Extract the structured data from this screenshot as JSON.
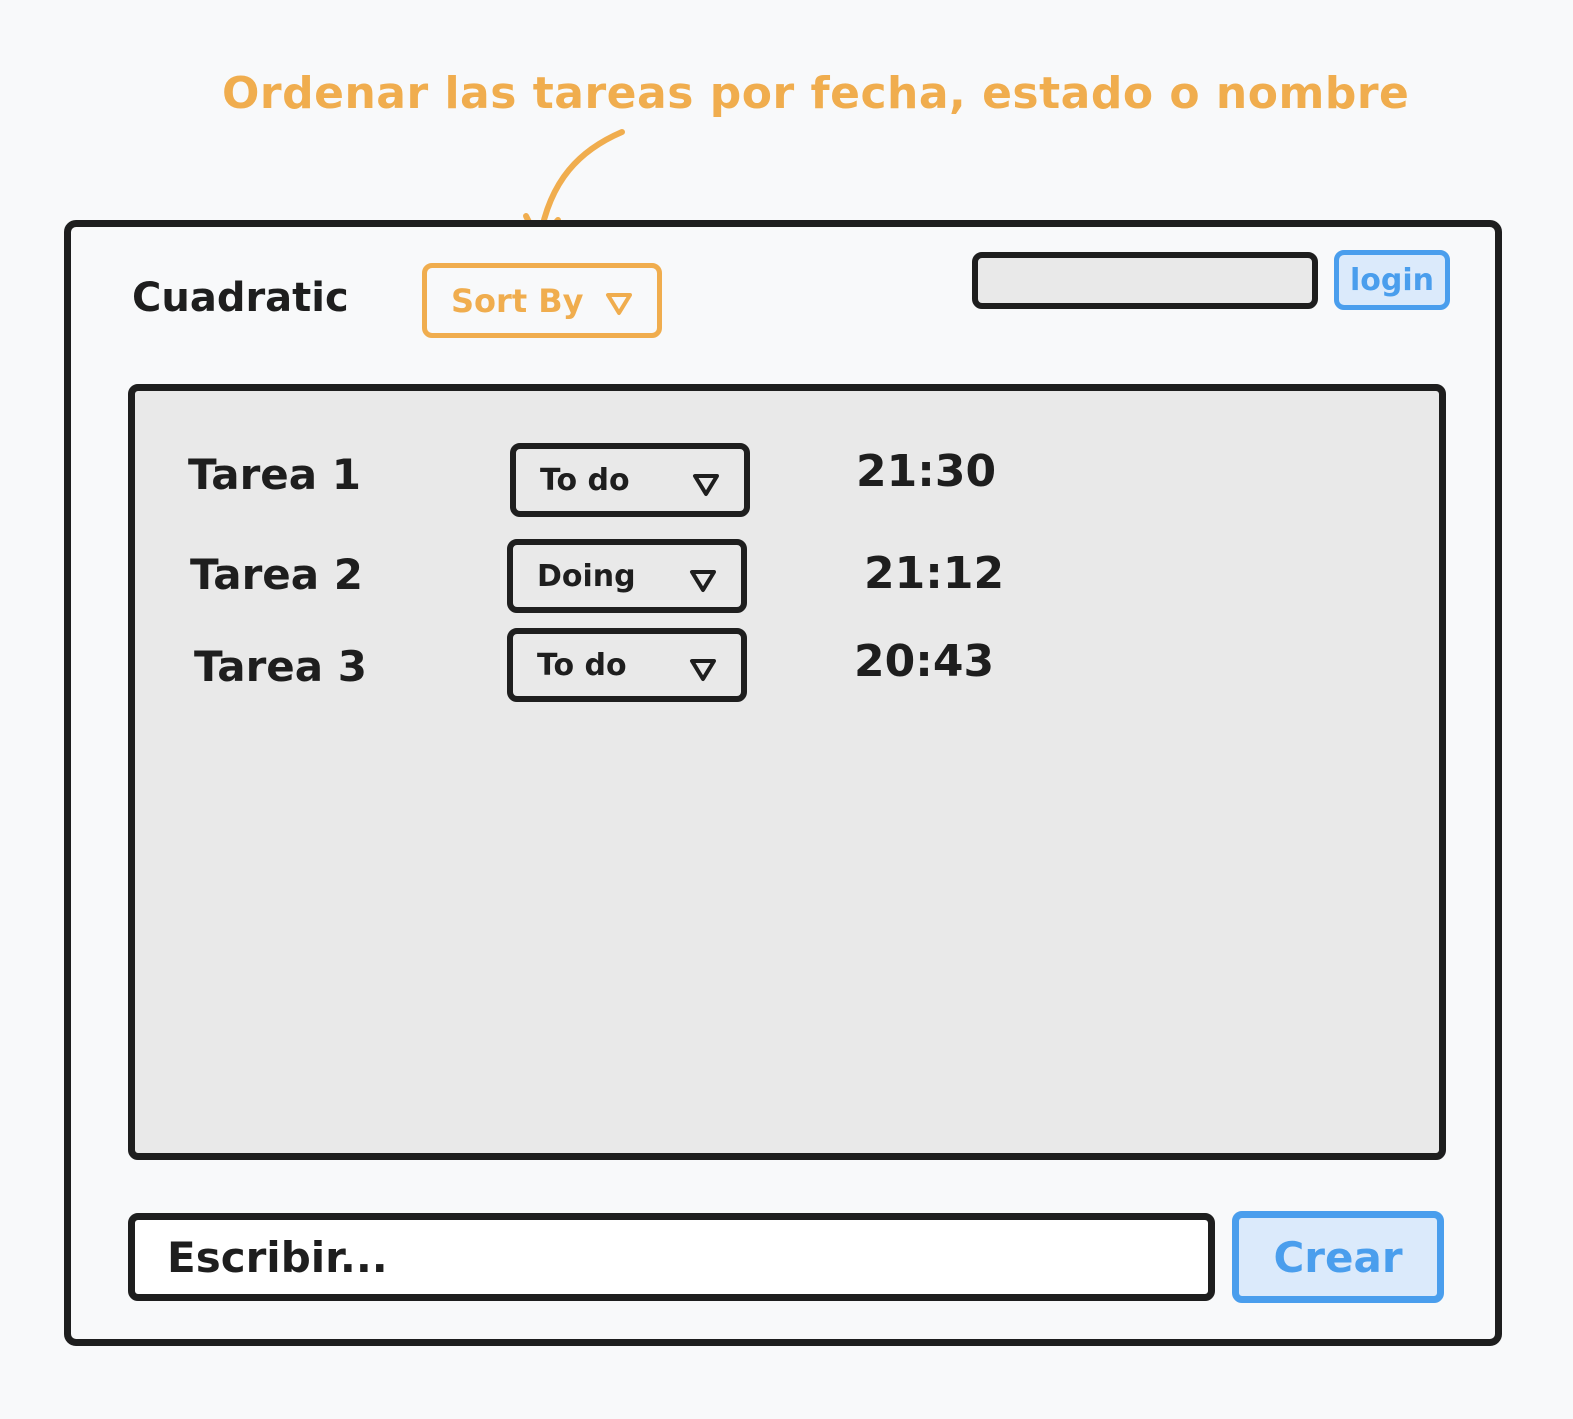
{
  "annotation": {
    "text": "Ordenar las tareas por fecha, estado o nombre",
    "color": "#f0ad4e"
  },
  "header": {
    "app_title": "Cuadratic",
    "sort_label": "Sort By",
    "login_label": "login",
    "search_value": ""
  },
  "tasks": [
    {
      "name": "Tarea 1",
      "status": "To do",
      "time": "21:30"
    },
    {
      "name": "Tarea 2",
      "status": "Doing",
      "time": "21:12"
    },
    {
      "name": "Tarea 3",
      "status": "To do",
      "time": "20:43"
    }
  ],
  "composer": {
    "placeholder": "Escribir...",
    "value": "",
    "create_label": "Crear"
  },
  "colors": {
    "accent_orange": "#f0ad4e",
    "accent_blue": "#4a9eed",
    "stroke": "#1e1e1e",
    "panel_fill": "#e9e9e9"
  },
  "icons": {
    "dropdown": "triangle-down-icon",
    "annotation_pointer": "curved-arrow-icon"
  }
}
